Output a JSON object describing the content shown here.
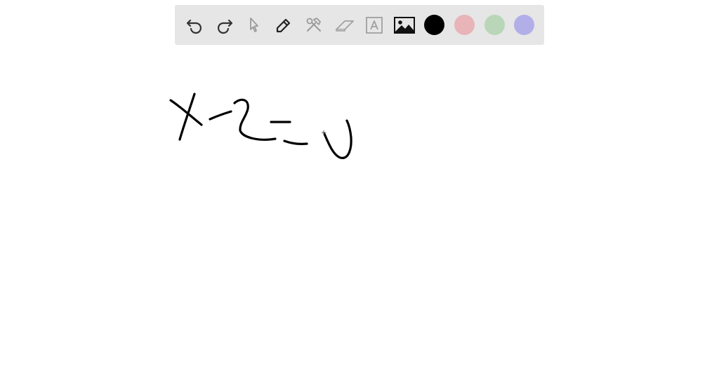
{
  "toolbar": {
    "tools": [
      {
        "icon": "undo-icon"
      },
      {
        "icon": "redo-icon"
      },
      {
        "icon": "select-pointer-icon"
      },
      {
        "icon": "pen-icon"
      },
      {
        "icon": "tools-icon"
      },
      {
        "icon": "eraser-icon"
      },
      {
        "icon": "text-box-icon"
      },
      {
        "icon": "image-icon"
      }
    ],
    "colors": [
      {
        "name": "black",
        "hex": "#000000",
        "selected": true
      },
      {
        "name": "pink",
        "hex": "#e8b4b8",
        "selected": false
      },
      {
        "name": "green",
        "hex": "#b9d6b9",
        "selected": false
      },
      {
        "name": "purple",
        "hex": "#b2aee8",
        "selected": false
      }
    ]
  },
  "canvas": {
    "ink_color": "#000000",
    "background": "#ffffff"
  }
}
